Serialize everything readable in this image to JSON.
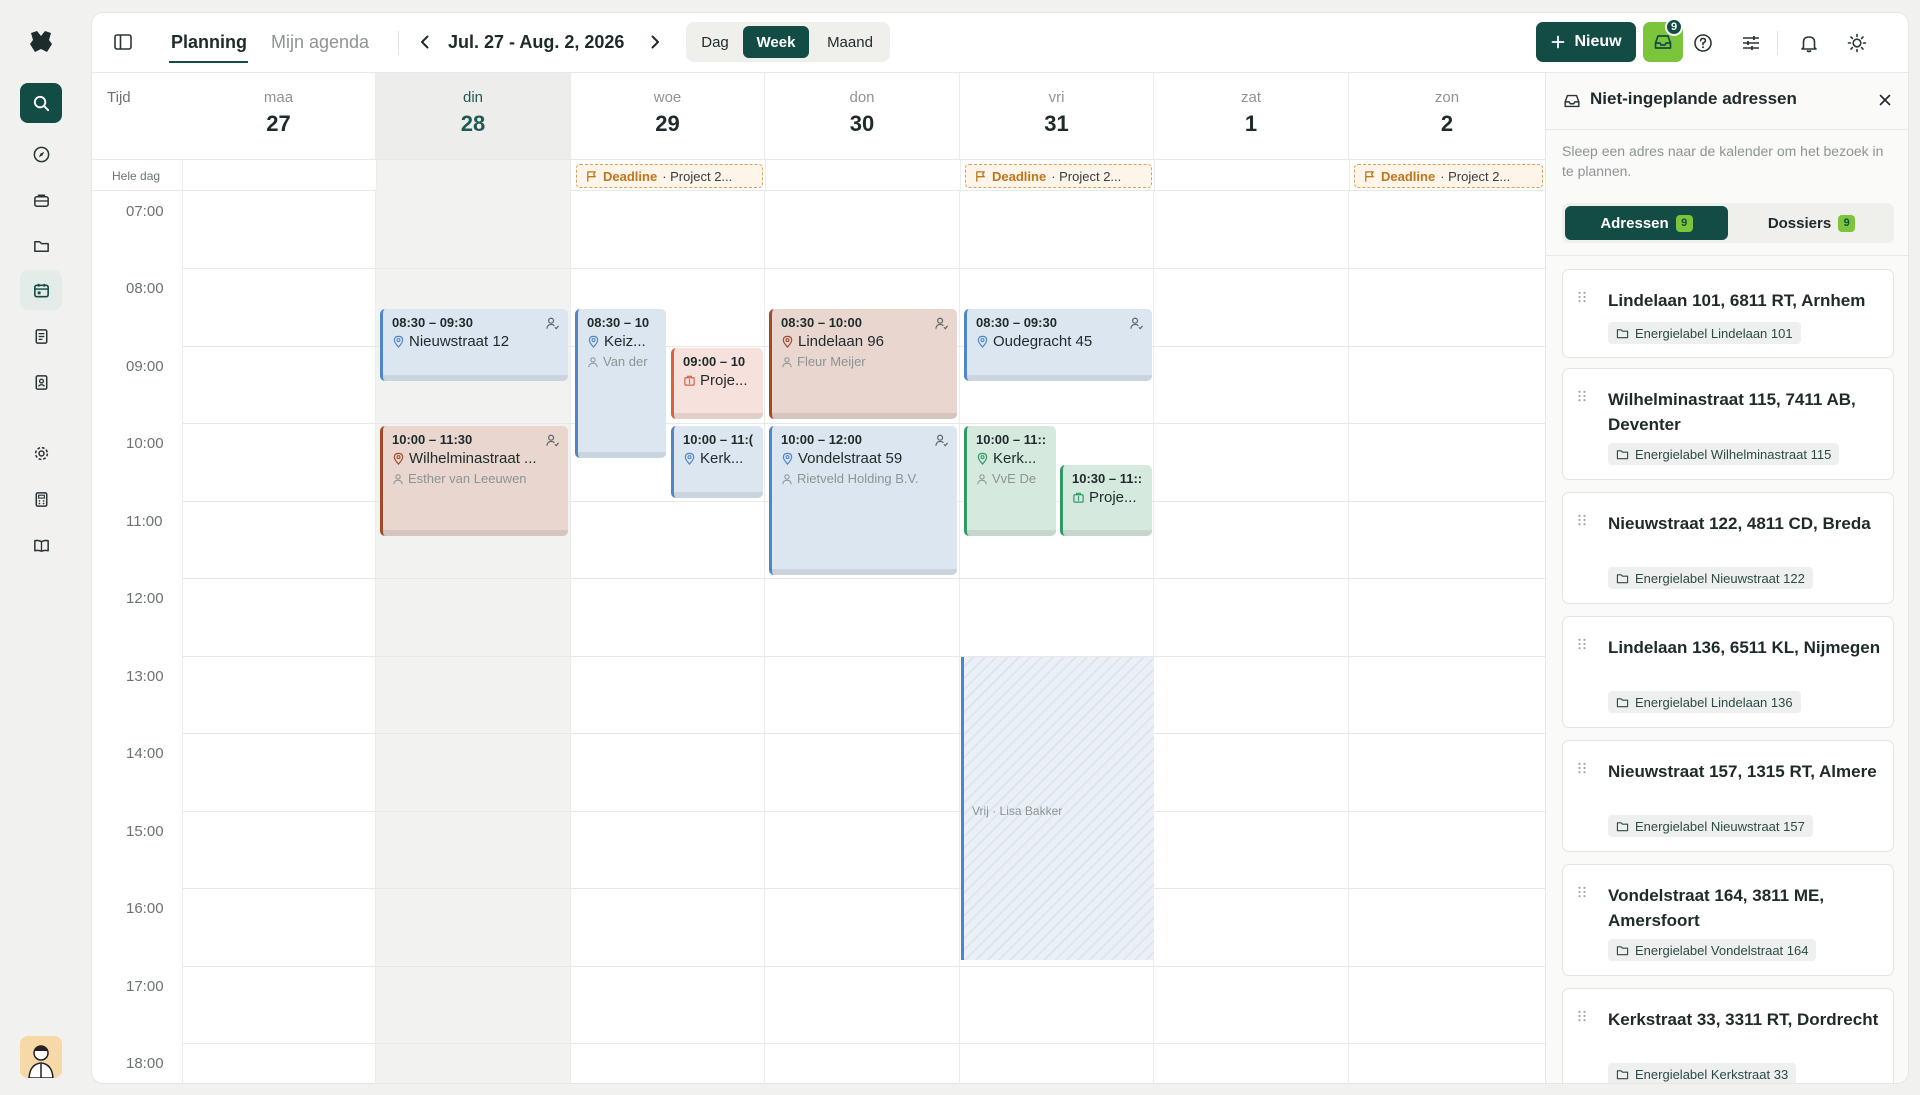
{
  "topbar": {
    "tab_planning": "Planning",
    "tab_agenda": "Mijn agenda",
    "range": "Jul. 27 - Aug. 2, 2026",
    "view_day": "Dag",
    "view_week": "Week",
    "view_month": "Maand",
    "new_label": "Nieuw",
    "inbox_count": "9"
  },
  "calendar": {
    "time_header": "Tijd",
    "allday_label": "Hele dag",
    "days": [
      {
        "name": "maa",
        "num": "27"
      },
      {
        "name": "din",
        "num": "28"
      },
      {
        "name": "woe",
        "num": "29"
      },
      {
        "name": "don",
        "num": "30"
      },
      {
        "name": "vri",
        "num": "31"
      },
      {
        "name": "zat",
        "num": "1"
      },
      {
        "name": "zon",
        "num": "2"
      }
    ],
    "hours": [
      "07:00",
      "08:00",
      "09:00",
      "10:00",
      "11:00",
      "12:00",
      "13:00",
      "14:00",
      "15:00",
      "16:00",
      "17:00",
      "18:00"
    ],
    "deadlines": [
      {
        "label": "Deadline",
        "text": "· Project 2..."
      },
      {
        "label": "Deadline",
        "text": "· Project 2..."
      },
      {
        "label": "Deadline",
        "text": "· Project 2..."
      }
    ],
    "events": [
      {
        "time": "08:30 – 09:30",
        "title": "Nieuwstraat 12",
        "person": ""
      },
      {
        "time": "10:00 – 11:30",
        "title": "Wilhelminastraat ...",
        "person": "Esther van Leeuwen"
      },
      {
        "time": "08:30 – 10",
        "title": "Keiz...",
        "person": "Van der"
      },
      {
        "time": "09:00 – 10",
        "title": "Proje..."
      },
      {
        "time": "10:00 – 11:(",
        "title": "Kerk..."
      },
      {
        "time": "08:30 – 10:00",
        "title": "Lindelaan 96",
        "person": "Fleur Meijer"
      },
      {
        "time": "10:00 – 12:00",
        "title": "Vondelstraat 59",
        "person": "Rietveld Holding B.V."
      },
      {
        "time": "08:30 – 09:30",
        "title": "Oudegracht 45",
        "person": ""
      },
      {
        "time": "10:00 – 11::",
        "title": "Kerk...",
        "person": "VvE De"
      },
      {
        "time": "10:30 – 11::",
        "title": "Proje..."
      }
    ],
    "vrij_label": "Vrij · Lisa Bakker"
  },
  "panel": {
    "title": "Niet-ingeplande adressen",
    "subtitle": "Sleep een adres naar de kalender om het bezoek in te plannen.",
    "tab_addresses": "Adressen",
    "tab_addresses_count": "9",
    "tab_dossiers": "Dossiers",
    "tab_dossiers_count": "9",
    "addresses": [
      {
        "name": "Lindelaan 101, 6811 RT, Arnhem",
        "tag": "Energielabel Lindelaan 101"
      },
      {
        "name": "Wilhelminastraat 115, 7411 AB, Deventer",
        "tag": "Energielabel Wilhelminastraat 115"
      },
      {
        "name": "Nieuwstraat 122, 4811 CD, Breda",
        "tag": "Energielabel Nieuwstraat 122"
      },
      {
        "name": "Lindelaan 136, 6511 KL, Nijmegen",
        "tag": "Energielabel Lindelaan 136"
      },
      {
        "name": "Nieuwstraat 157, 1315 RT, Almere",
        "tag": "Energielabel Nieuwstraat 157"
      },
      {
        "name": "Vondelstraat 164, 3811 ME, Amersfoort",
        "tag": "Energielabel Vondelstraat 164"
      },
      {
        "name": "Kerkstraat 33, 3311 RT, Dordrecht",
        "tag": "Energielabel Kerkstraat 33"
      }
    ]
  },
  "colors": {
    "brand": "#134c44",
    "accent_green": "#7cc43b",
    "event_blue": "#4f86c6",
    "event_brown": "#a04a2c",
    "event_red": "#d9633f",
    "event_green": "#2f9a66",
    "deadline": "#c2751a"
  }
}
